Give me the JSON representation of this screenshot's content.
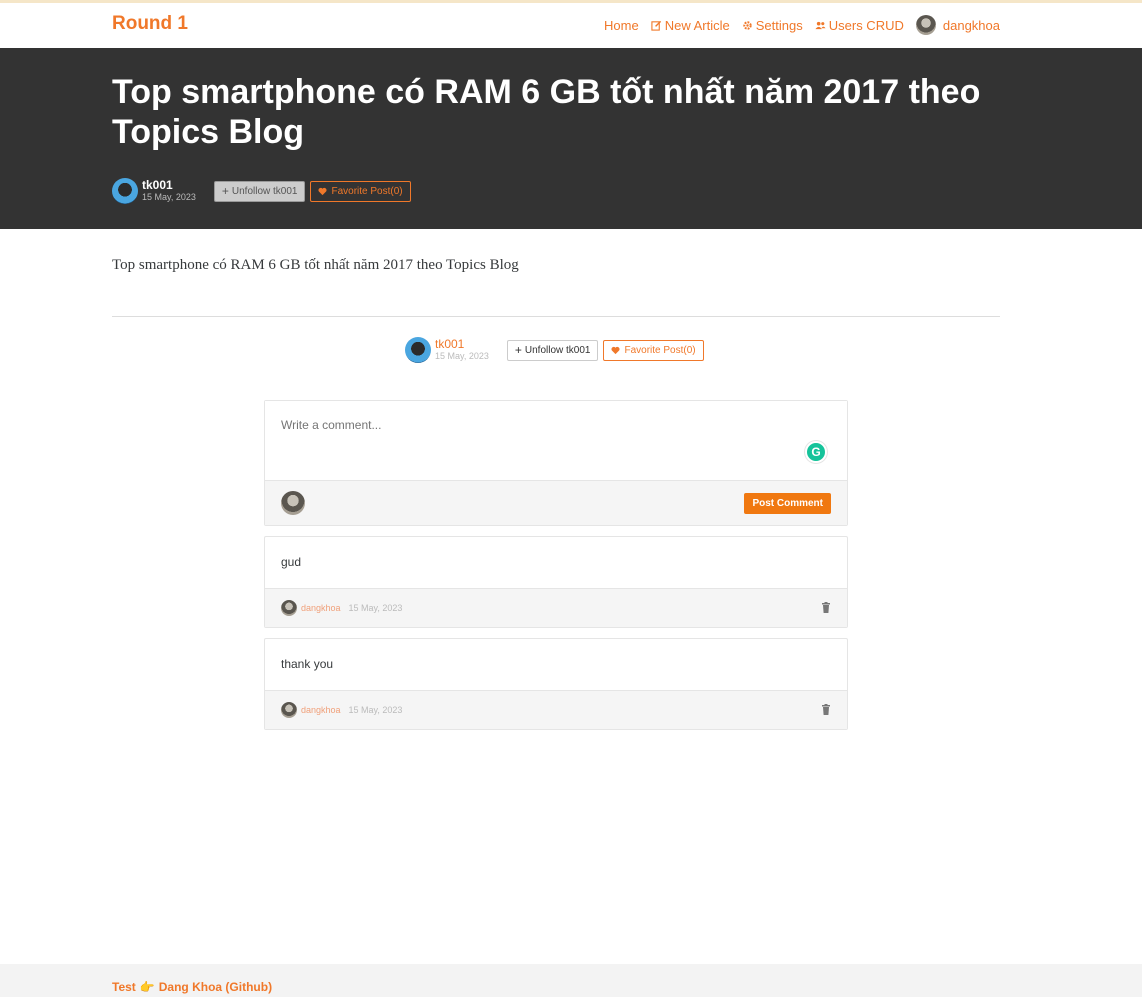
{
  "nav": {
    "brand": "Round 1",
    "links": [
      {
        "label": "Home",
        "icon": "none"
      },
      {
        "label": "New Article",
        "icon": "edit-icon"
      },
      {
        "label": "Settings",
        "icon": "gear-icon"
      },
      {
        "label": "Users CRUD",
        "icon": "users-icon"
      },
      {
        "label": "dangkhoa",
        "icon": "avatar"
      }
    ]
  },
  "article": {
    "title": "Top smartphone có RAM 6 GB tốt nhất năm 2017 theo Topics Blog",
    "author": "tk001",
    "date": "15 May, 2023",
    "unfollow_label": "Unfollow tk001",
    "favorite_label": "Favorite Post(0)",
    "body": "Top smartphone có RAM 6 GB tốt nhất năm 2017 theo Topics Blog"
  },
  "comment_form": {
    "placeholder": "Write a comment...",
    "submit_label": "Post Comment"
  },
  "comments": [
    {
      "text": "gud",
      "author": "dangkhoa",
      "date": "15 May, 2023"
    },
    {
      "text": "thank you",
      "author": "dangkhoa",
      "date": "15 May, 2023"
    }
  ],
  "footer": {
    "text": "Test",
    "emoji": "👉",
    "link": "Dang Khoa (Github)"
  },
  "colors": {
    "accent": "#f0782a",
    "banner": "#333333",
    "footer_bg": "#f3f3f3"
  }
}
